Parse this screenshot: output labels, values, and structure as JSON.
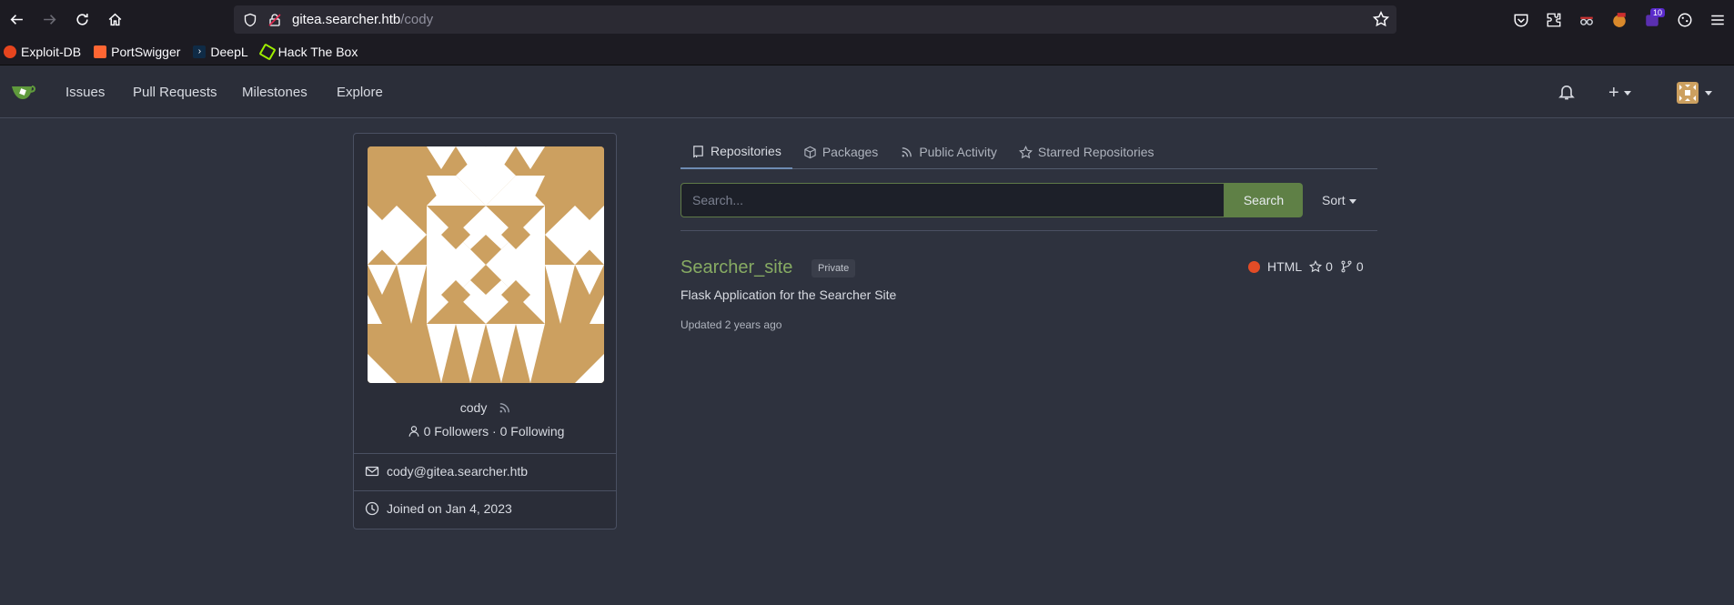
{
  "browser": {
    "url_host": "gitea.searcher.htb",
    "url_path": "/cody",
    "extension_badge": "10",
    "bookmarks": [
      {
        "label": "Exploit-DB",
        "color": "#e6451e"
      },
      {
        "label": "PortSwigger",
        "color": "#ff6633"
      },
      {
        "label": "DeepL",
        "color": "#0f2b46"
      },
      {
        "label": "Hack The Box",
        "color": "#9fef00"
      }
    ]
  },
  "navbar": {
    "items": [
      "Issues",
      "Pull Requests",
      "Milestones",
      "Explore"
    ]
  },
  "profile": {
    "username": "cody",
    "followers": "0 Followers · 0 Following",
    "email": "cody@gitea.searcher.htb",
    "joined": "Joined on Jan 4, 2023",
    "avatar_color": "#cca060"
  },
  "tabs": [
    {
      "label": "Repositories",
      "icon": "repo-icon",
      "active": true
    },
    {
      "label": "Packages",
      "icon": "package-icon"
    },
    {
      "label": "Public Activity",
      "icon": "rss-icon"
    },
    {
      "label": "Starred Repositories",
      "icon": "star-icon"
    }
  ],
  "search": {
    "placeholder": "Search...",
    "button": "Search",
    "sort": "Sort"
  },
  "repo": {
    "name": "Searcher_site",
    "badge": "Private",
    "language": "HTML",
    "language_color": "#e34c26",
    "stars": "0",
    "forks": "0",
    "description": "Flask Application for the Searcher Site",
    "updated": "Updated 2 years ago"
  }
}
